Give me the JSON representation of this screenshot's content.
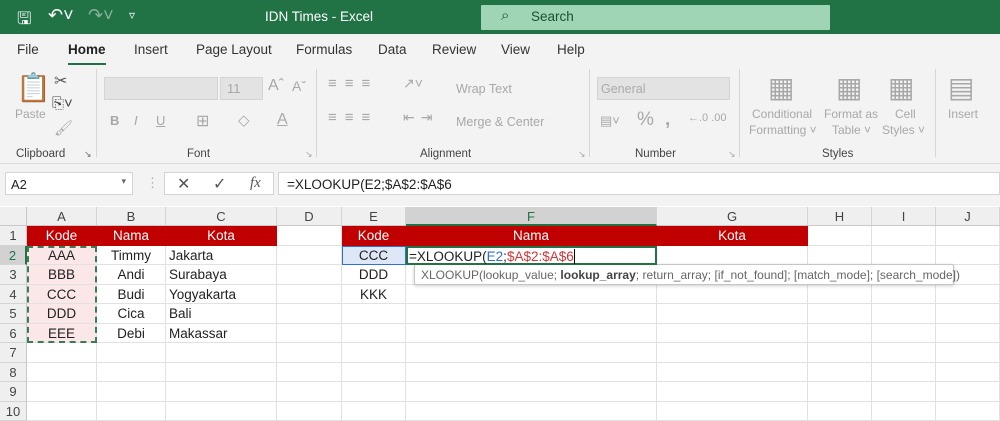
{
  "titlebar": {
    "title": "IDN Times  -  Excel",
    "search_placeholder": "Search"
  },
  "tabs": [
    {
      "label": "File"
    },
    {
      "label": "Home"
    },
    {
      "label": "Insert"
    },
    {
      "label": "Page Layout"
    },
    {
      "label": "Formulas"
    },
    {
      "label": "Data"
    },
    {
      "label": "Review"
    },
    {
      "label": "View"
    },
    {
      "label": "Help"
    }
  ],
  "ribbon": {
    "clipboard": {
      "label": "Clipboard",
      "paste": "Paste"
    },
    "font": {
      "label": "Font",
      "size": "11",
      "bold": "B",
      "italic": "I",
      "underline": "U",
      "grow": "Aˆ",
      "shrink": "Aˇ",
      "color": "A"
    },
    "alignment": {
      "label": "Alignment",
      "wrap": "Wrap Text",
      "merge": "Merge & Center"
    },
    "number": {
      "label": "Number",
      "format": "General",
      "percent": "%",
      "comma": "9"
    },
    "styles": {
      "label": "Styles",
      "conditional_1": "Conditional",
      "conditional_2": "Formatting ˅",
      "format_table_1": "Format as",
      "format_table_2": "Table ˅",
      "cell_styles_1": "Cell",
      "cell_styles_2": "Styles ˅"
    },
    "cells": {
      "insert": "Insert"
    }
  },
  "formula_bar": {
    "name_box": "A2",
    "fx": "fx",
    "formula": "=XLOOKUP(E2;$A$2:$A$6"
  },
  "sheet": {
    "columns": [
      "A",
      "B",
      "C",
      "D",
      "E",
      "F",
      "G",
      "H",
      "I",
      "J"
    ],
    "rows": [
      "1",
      "2",
      "3",
      "4",
      "5",
      "6",
      "7",
      "8",
      "9",
      "10"
    ],
    "header_row": {
      "A": "Kode",
      "B": "Nama",
      "C": "Kota",
      "E": "Kode",
      "F": "Nama",
      "G": "Kota"
    },
    "data": [
      {
        "A": "AAA",
        "B": "Timmy",
        "C": "Jakarta",
        "E": "CCC"
      },
      {
        "A": "BBB",
        "B": "Andi",
        "C": "Surabaya",
        "E": "DDD"
      },
      {
        "A": "CCC",
        "B": "Budi",
        "C": "Yogyakarta",
        "E": "KKK"
      },
      {
        "A": "DDD",
        "B": "Cica",
        "C": "Bali"
      },
      {
        "A": "EEE",
        "B": "Debi",
        "C": "Makassar"
      }
    ],
    "editing_cell": {
      "prefix": "=XLOOKUP(",
      "ref1": "E2",
      "sep": ";",
      "ref2": "$A$2:$A$6"
    },
    "tooltip": {
      "fn": "XLOOKUP(lookup_value; ",
      "bold_arg": "lookup_array",
      "rest": "; return_array; [if_not_found]; [match_mode]; [search_mode])"
    }
  },
  "colors": {
    "accent": "#217346",
    "header_red": "#c00000",
    "ref_blue": "#2f6fd6",
    "ref_red": "#d13438"
  }
}
